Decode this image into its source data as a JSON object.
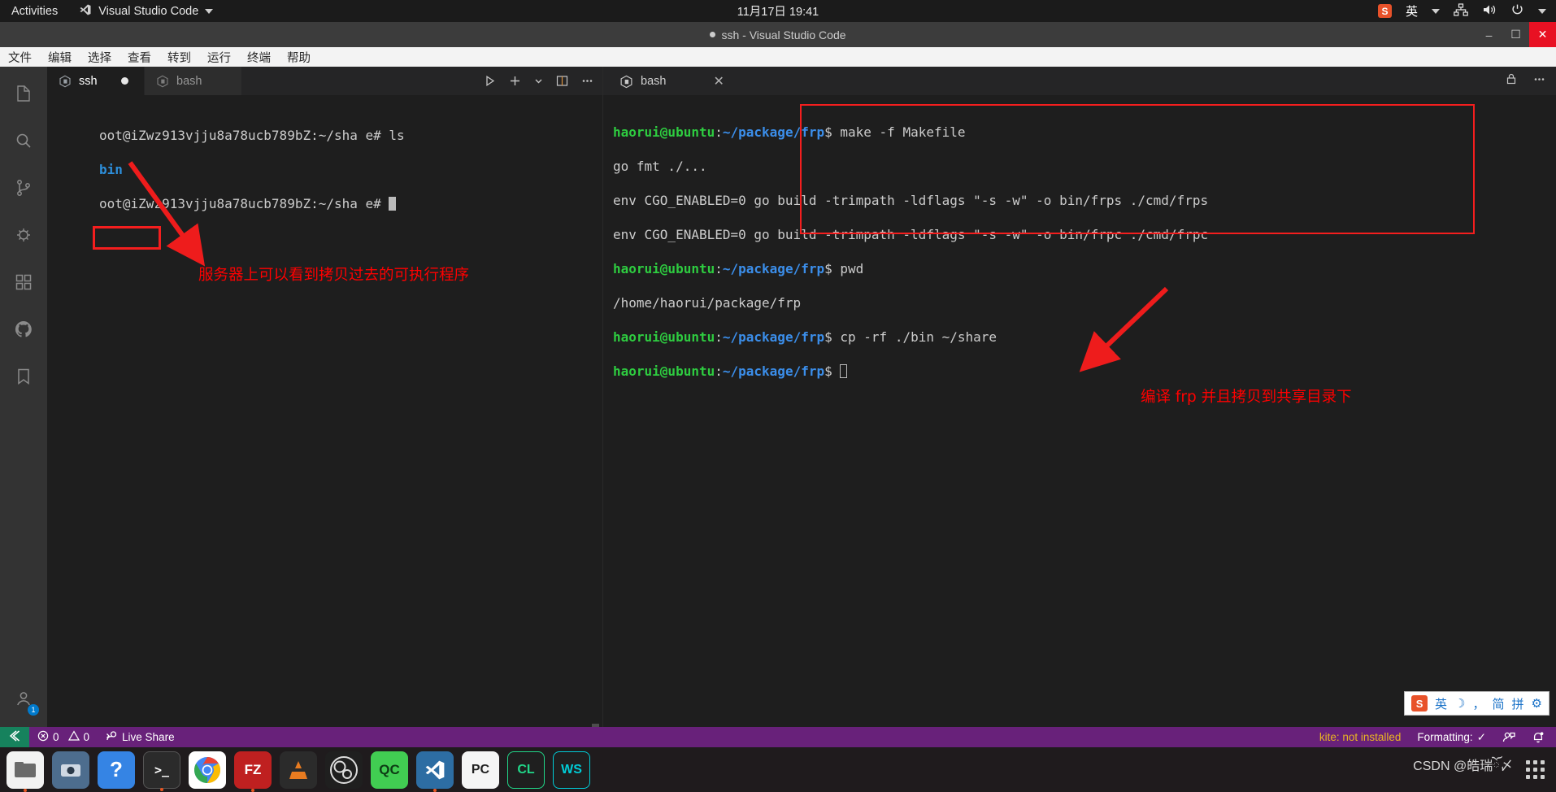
{
  "gnome": {
    "activities": "Activities",
    "app_name": "Visual Studio Code",
    "clock": "11月17日  19:41",
    "tray": {
      "sogou_logo": "S",
      "input_method": "英",
      "network_icon": "network-icon",
      "volume_icon": "volume-icon",
      "power_icon": "power-icon"
    }
  },
  "window": {
    "title": "ssh - Visual Studio Code",
    "minimize": "–",
    "maximize": "☐",
    "close": "✕"
  },
  "menubar": [
    "文件",
    "编辑",
    "选择",
    "查看",
    "转到",
    "运行",
    "终端",
    "帮助"
  ],
  "activitybar": [
    {
      "name": "explorer",
      "icon": "files-icon"
    },
    {
      "name": "search",
      "icon": "search-icon"
    },
    {
      "name": "source-control",
      "icon": "source-control-icon"
    },
    {
      "name": "run-debug",
      "icon": "run-debug-icon"
    },
    {
      "name": "extensions",
      "icon": "extensions-icon"
    },
    {
      "name": "github",
      "icon": "github-icon"
    },
    {
      "name": "bookmarks",
      "icon": "bookmark-icon"
    },
    {
      "name": "accounts",
      "icon": "account-icon",
      "badge": "1"
    },
    {
      "name": "manage",
      "icon": "gear-icon",
      "badge": "1"
    }
  ],
  "editor": {
    "tabs": [
      {
        "label": "ssh",
        "icon": "terminal-cube-icon",
        "active": true,
        "dirty": true
      },
      {
        "label": "bash",
        "icon": "terminal-cube-icon",
        "active": false,
        "dirty": false
      }
    ],
    "actions": [
      "run-icon",
      "split-add-icon",
      "chevron-down-icon",
      "split-editor-icon",
      "more-actions-icon"
    ]
  },
  "left_terminal": {
    "lines": [
      {
        "prompt": "oot@iZwz913vjju8a78ucb789bZ:~/sha e#",
        "command": " ls"
      },
      {
        "output": "bin",
        "highlighted": true
      },
      {
        "prompt": "oot@iZwz913vjju8a78ucb789bZ:~/sha e#",
        "command": " ",
        "cursor": true
      }
    ]
  },
  "panel": {
    "tab": {
      "label": "bash",
      "icon": "terminal-cube-icon"
    },
    "close_icon": "close-icon",
    "actions": [
      "lock-icon",
      "more-actions-icon"
    ]
  },
  "right_terminal": {
    "user": "haorui@ubuntu",
    "colon": ":",
    "path": "~/package/frp",
    "sigil": "$",
    "lines": [
      {
        "type": "prompt",
        "command": " make -f Makefile"
      },
      {
        "type": "output",
        "text": "go fmt ./..."
      },
      {
        "type": "output",
        "text": "env CGO_ENABLED=0 go build -trimpath -ldflags \"-s -w\" -o bin/frps ./cmd/frps"
      },
      {
        "type": "output",
        "text": "env CGO_ENABLED=0 go build -trimpath -ldflags \"-s -w\" -o bin/frpc ./cmd/frpc"
      },
      {
        "type": "prompt",
        "command": " pwd"
      },
      {
        "type": "output",
        "text": "/home/haorui/package/frp"
      },
      {
        "type": "prompt",
        "command": " cp -rf ./bin ~/share"
      },
      {
        "type": "prompt",
        "command": " ",
        "cursor": true
      }
    ]
  },
  "annotations": [
    {
      "text": "服务器上可以看到拷贝过去的可执行程序",
      "color": "#ff0000"
    },
    {
      "text": "编译 frp 并且拷贝到共享目录下",
      "color": "#ff0000"
    }
  ],
  "statusbar": {
    "remote_icon": "remote-ssh-icon",
    "errors": "0",
    "warnings": "0",
    "live_share": "Live Share",
    "kite": "kite: not installed",
    "formatting": "Formatting:",
    "formatting_state": "✓",
    "feedback_icon": "feedback-icon",
    "bell_icon": "bell-icon"
  },
  "dock": {
    "apps": [
      {
        "name": "files",
        "label": "",
        "color": "#f2f2f2"
      },
      {
        "name": "camera",
        "label": "",
        "color": "#5d9bd5"
      },
      {
        "name": "help",
        "label": "?",
        "color": "#3584e4"
      },
      {
        "name": "terminal",
        "label": ">_",
        "color": "#2b2b2b"
      },
      {
        "name": "chrome",
        "label": "",
        "color": "#ffffff"
      },
      {
        "name": "filezilla",
        "label": "FZ",
        "color": "#bf2020"
      },
      {
        "name": "vlc",
        "label": "",
        "color": "#e87b20"
      },
      {
        "name": "obs",
        "label": "",
        "color": "#2b2b2b"
      },
      {
        "name": "qt-creator",
        "label": "QC",
        "color": "#41cd52"
      },
      {
        "name": "vscode",
        "label": "",
        "color": "#2d6da3"
      },
      {
        "name": "pycharm",
        "label": "PC",
        "color": "#f5f5f5"
      },
      {
        "name": "clion",
        "label": "CL",
        "color": "#21d789"
      },
      {
        "name": "webstorm",
        "label": "WS",
        "color": "#00cdd7"
      }
    ],
    "show_apps": "show-applications-icon",
    "watermark": "CSDN @皓瑞ོ〆"
  },
  "ime": {
    "logo": "S",
    "lang": "英",
    "moon": "☽",
    "comma": "，",
    "simplified": "简",
    "pinyin": "拼",
    "settings": "⚙"
  }
}
